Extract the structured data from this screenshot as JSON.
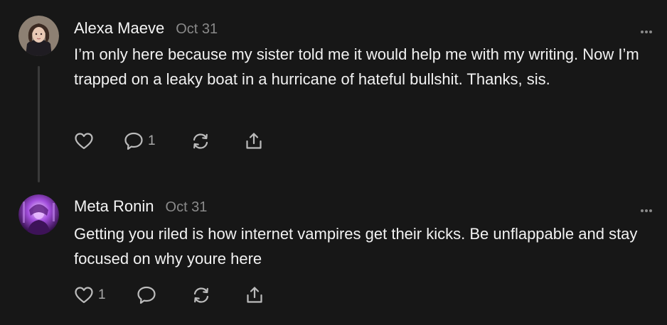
{
  "posts": [
    {
      "author": "Alexa Maeve",
      "date": "Oct 31",
      "text": "I’m only here because my sister told me it would help me with my writing. Now I’m trapped on a leaky boat in a hurricane of hateful bullshit. Thanks, sis.",
      "like_count": "",
      "comment_count": "1",
      "avatar_icon": "portrait-photo-icon"
    },
    {
      "author": "Meta Ronin",
      "date": "Oct 31",
      "text": "Getting you riled is how internet vampires get their kicks. Be unflappable and stay focused on why youre here",
      "like_count": "1",
      "comment_count": "",
      "avatar_icon": "purple-portrait-icon"
    }
  ],
  "colors": {
    "background": "#171717",
    "primary_text": "#f2f2f2",
    "secondary_text": "#8a8a8a",
    "icon": "#bcbcbc",
    "thread_line": "#3a3a3a"
  },
  "icons": [
    "heart-icon",
    "comment-icon",
    "restack-icon",
    "share-icon",
    "more-options-icon"
  ]
}
